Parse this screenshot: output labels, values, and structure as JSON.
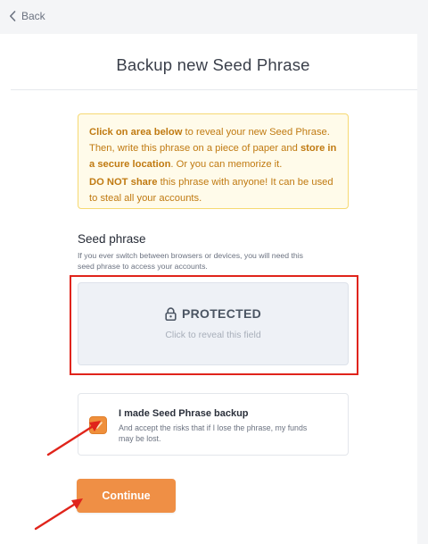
{
  "nav": {
    "back_label": "Back",
    "back_icon": "chevron-left-icon"
  },
  "page": {
    "title": "Backup new Seed Phrase"
  },
  "notice": {
    "p1_bold_a": "Click on area below",
    "p1_text_a": " to reveal your new Seed Phrase. Then, write this phrase on a piece of paper and ",
    "p1_bold_b": "store in a secure location",
    "p1_text_b": ". Or you can memorize it.",
    "p2_bold": "DO NOT share",
    "p2_text": " this phrase with anyone! It can be used to steal all your accounts."
  },
  "seed": {
    "label": "Seed phrase",
    "help": "If you ever switch between browsers or devices, you will need this seed phrase to access your accounts.",
    "protected_title": "PROTECTED",
    "protected_sub": "Click to reveal this field",
    "lock_icon": "lock-icon"
  },
  "confirm": {
    "checked": true,
    "title": "I made Seed Phrase backup",
    "sub": "And accept the risks that if I lose the phrase, my funds may be lost."
  },
  "actions": {
    "continue_label": "Continue"
  },
  "colors": {
    "accent": "#ef8f45",
    "highlight": "#e0241b",
    "notice_bg": "#fffbea",
    "notice_text": "#c07a11"
  }
}
